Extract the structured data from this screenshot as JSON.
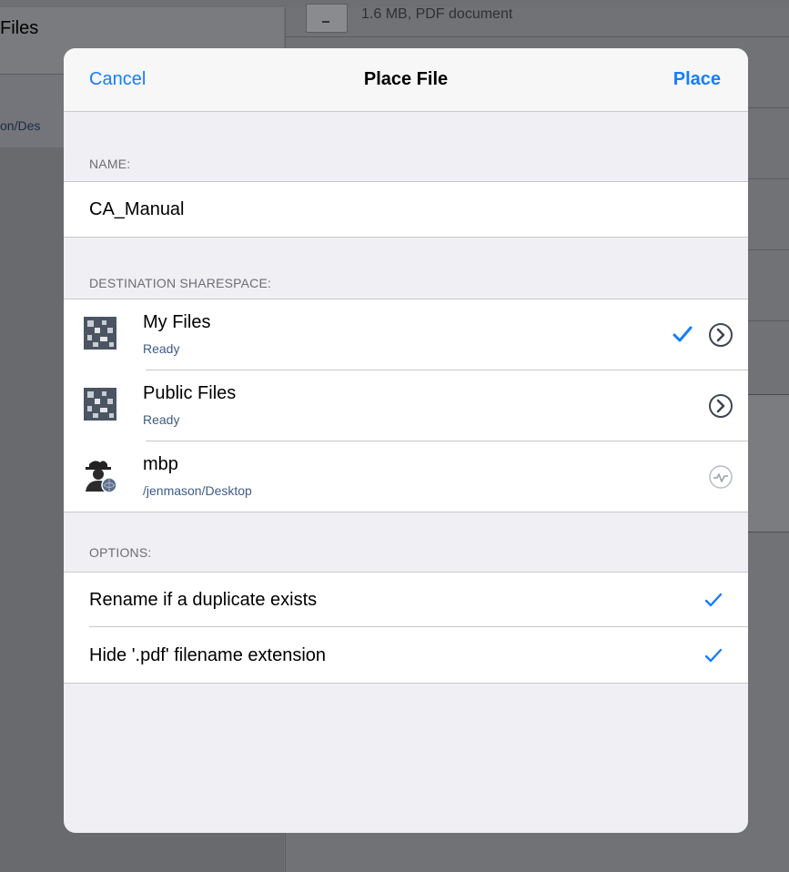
{
  "background": {
    "left_title": "Files",
    "left_path": "on/Des",
    "doc_subtitle": "1.6 MB, PDF document"
  },
  "modal": {
    "cancel_label": "Cancel",
    "title": "Place File",
    "place_label": "Place",
    "name_section": {
      "header": "NAME:",
      "value": "CA_Manual"
    },
    "destination_section": {
      "header": "DESTINATION SHARESPACE:",
      "items": [
        {
          "title": "My Files",
          "subtitle": "Ready",
          "icon": "sharespace-icon",
          "selected": true,
          "accessory": "disclosure-icon"
        },
        {
          "title": "Public Files",
          "subtitle": "Ready",
          "icon": "sharespace-icon",
          "selected": false,
          "accessory": "disclosure-icon"
        },
        {
          "title": "mbp",
          "subtitle": "/jenmason/Desktop",
          "icon": "remote-user-icon",
          "selected": false,
          "accessory": "activity-icon"
        }
      ]
    },
    "options_section": {
      "header": "OPTIONS:",
      "items": [
        {
          "label": "Rename if a duplicate exists",
          "checked": true
        },
        {
          "label": "Hide '.pdf' filename extension",
          "checked": true
        }
      ]
    }
  },
  "colors": {
    "accent": "#147efb",
    "subtitle": "#3e5b86",
    "section_header": "#6d6d72",
    "modal_bg": "#efeff4"
  }
}
